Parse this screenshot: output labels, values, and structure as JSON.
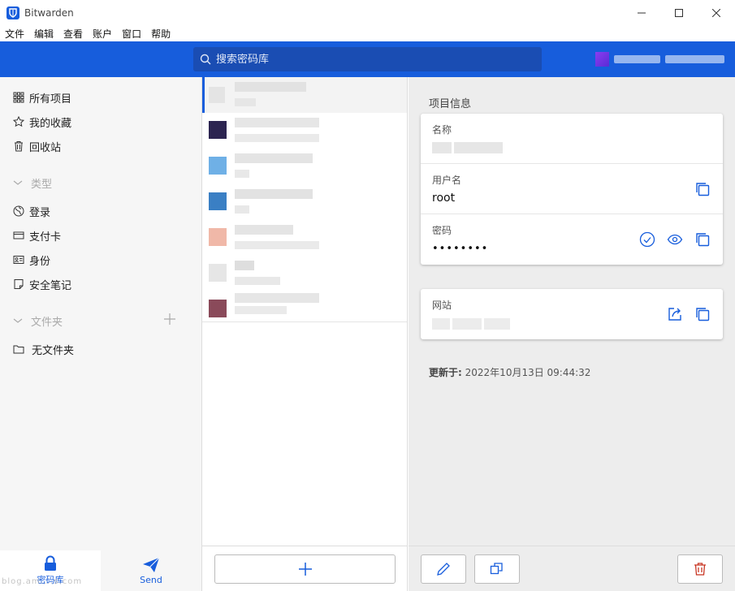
{
  "window": {
    "title": "Bitwarden"
  },
  "menu": [
    "文件",
    "编辑",
    "查看",
    "账户",
    "窗口",
    "帮助"
  ],
  "search": {
    "placeholder": "搜索密码库"
  },
  "sidebar": {
    "all_items": "所有项目",
    "favorites": "我的收藏",
    "trash": "回收站",
    "types_heading": "类型",
    "types": [
      "登录",
      "支付卡",
      "身份",
      "安全笔记"
    ],
    "folders_heading": "文件夹",
    "no_folder": "无文件夹"
  },
  "bottom_nav": {
    "vault": "密码库",
    "send": "Send"
  },
  "watermark": "blog.am....s.com",
  "details": {
    "section_title": "项目信息",
    "name_label": "名称",
    "username_label": "用户名",
    "username_value": "root",
    "password_label": "密码",
    "password_value": "••••••••",
    "website_label": "网站",
    "updated_label": "更新于:",
    "updated_value": "2022年10月13日 09:44:32"
  },
  "colors": {
    "brand": "#175ddc",
    "danger": "#c83522"
  }
}
